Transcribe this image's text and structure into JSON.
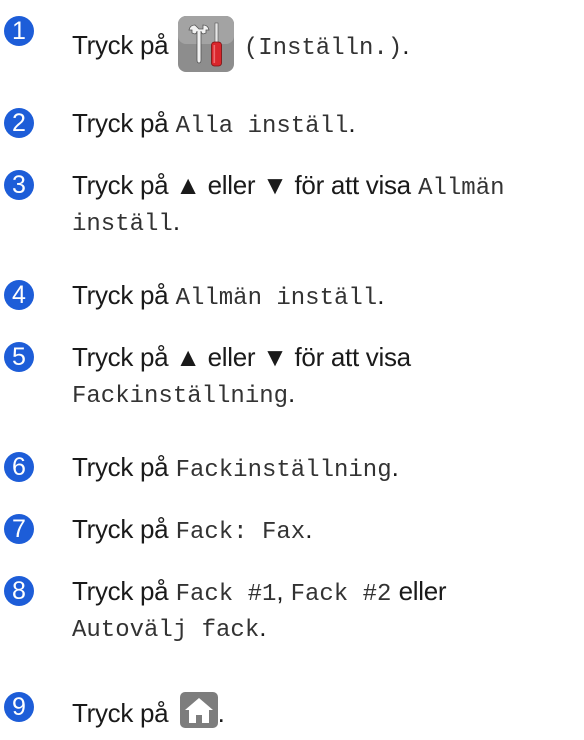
{
  "colors": {
    "step_number_bg": "#1d5dd8",
    "icon_tile_bg": "#8d8d8d",
    "screwdriver_handle": "#d9262c"
  },
  "step1": {
    "number": "1",
    "prefix": "Tryck på",
    "icon": "settings-tools-icon",
    "suffix": "(Inställn.)",
    "end": "."
  },
  "step2": {
    "number": "2",
    "prefix": "Tryck på",
    "code": "Alla inställ",
    "end": "."
  },
  "step3": {
    "number": "3",
    "prefix": "Tryck på ▲ eller ▼ för att visa",
    "code_line1": "Allmän",
    "code_line2": "inställ",
    "end": "."
  },
  "step4": {
    "number": "4",
    "prefix": "Tryck på",
    "code": "Allmän inställ",
    "end": "."
  },
  "step5": {
    "number": "5",
    "prefix": "Tryck på ▲ eller ▼ för att visa",
    "code": "Fackinställning",
    "end": "."
  },
  "step6": {
    "number": "6",
    "prefix": "Tryck på",
    "code": "Fackinställning",
    "end": "."
  },
  "step7": {
    "number": "7",
    "prefix": "Tryck på",
    "code": "Fack: Fax",
    "end": "."
  },
  "step8": {
    "number": "8",
    "prefix": "Tryck på",
    "code1": "Fack #1",
    "sep": ",",
    "code2": "Fack #2",
    "or": "eller",
    "code3": "Autovälj fack",
    "end": "."
  },
  "step9": {
    "number": "9",
    "prefix": "Tryck på",
    "icon": "home-icon",
    "end": "."
  }
}
